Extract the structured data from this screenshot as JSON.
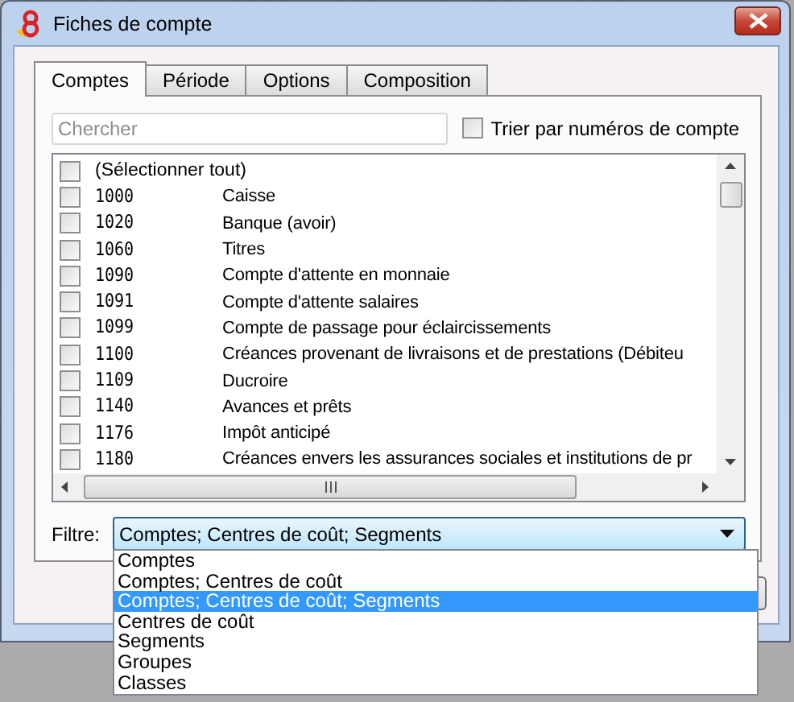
{
  "window": {
    "title": "Fiches de compte"
  },
  "tabs": [
    {
      "label": "Comptes",
      "selected": true
    },
    {
      "label": "Période",
      "selected": false
    },
    {
      "label": "Options",
      "selected": false
    },
    {
      "label": "Composition",
      "selected": false
    }
  ],
  "search": {
    "placeholder": "Chercher"
  },
  "sort_option": {
    "label": "Trier par numéros de compte",
    "checked": false
  },
  "account_list": {
    "select_all": {
      "label": "(Sélectionner tout)",
      "checked": false
    },
    "rows": [
      {
        "number": "1000",
        "description": "Caisse",
        "checked": false
      },
      {
        "number": "1020",
        "description": "Banque (avoir)",
        "checked": false
      },
      {
        "number": "1060",
        "description": "Titres",
        "checked": false
      },
      {
        "number": "1090",
        "description": "Compte d'attente en monnaie",
        "checked": false
      },
      {
        "number": "1091",
        "description": "Compte d'attente salaires",
        "checked": false
      },
      {
        "number": "1099",
        "description": "Compte de passage pour éclaircissements",
        "checked": false
      },
      {
        "number": "1100",
        "description": "Créances provenant de livraisons et de prestations (Débiteu",
        "checked": false
      },
      {
        "number": "1109",
        "description": "Ducroire",
        "checked": false
      },
      {
        "number": "1140",
        "description": "Avances et prêts",
        "checked": false
      },
      {
        "number": "1176",
        "description": "Impôt anticipé",
        "checked": false
      },
      {
        "number": "1180",
        "description": "Créances envers les assurances sociales et institutions de pr",
        "checked": false
      }
    ]
  },
  "filter": {
    "label": "Filtre:",
    "value": "Comptes; Centres de coût; Segments",
    "expanded": true,
    "options": [
      {
        "label": "Comptes",
        "selected": false
      },
      {
        "label": "Comptes; Centres de coût",
        "selected": false
      },
      {
        "label": "Comptes; Centres de coût; Segments",
        "selected": true
      },
      {
        "label": "Centres de coût",
        "selected": false
      },
      {
        "label": "Segments",
        "selected": false
      },
      {
        "label": "Groupes",
        "selected": false
      },
      {
        "label": "Classes",
        "selected": false
      }
    ]
  }
}
